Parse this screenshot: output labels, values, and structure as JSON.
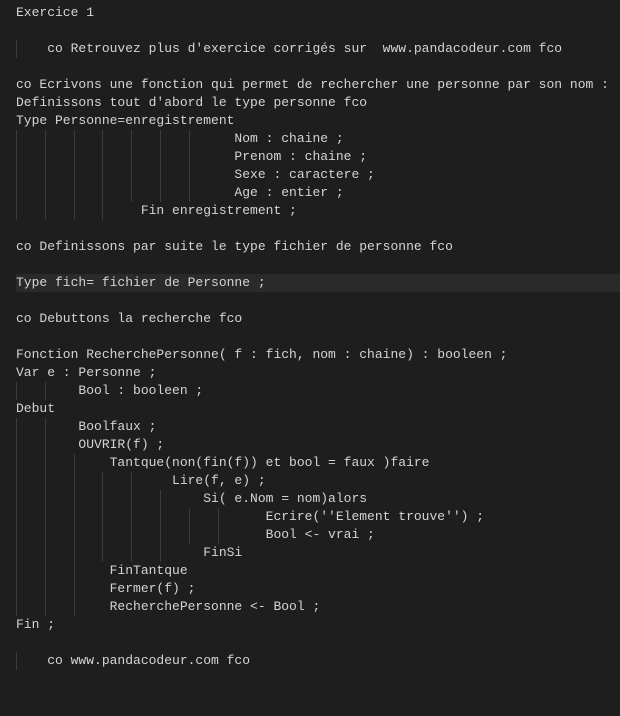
{
  "code": {
    "lines": [
      {
        "indent": 0,
        "guides": 0,
        "text": "Exercice 1",
        "hl": false
      },
      {
        "indent": 0,
        "guides": 0,
        "text": "",
        "hl": false
      },
      {
        "indent": 1,
        "guides": 1,
        "text": "co Retrouvez plus d'exercice corrigés sur  www.pandacodeur.com fco",
        "hl": false
      },
      {
        "indent": 0,
        "guides": 0,
        "text": "",
        "hl": false
      },
      {
        "indent": 0,
        "guides": 0,
        "text": "co Ecrivons une fonction qui permet de rechercher une personne par son nom :",
        "hl": false
      },
      {
        "indent": 0,
        "guides": 0,
        "text": "Definissons tout d'abord le type personne fco",
        "hl": false
      },
      {
        "indent": 0,
        "guides": 0,
        "text": "Type Personne=enregistrement",
        "hl": false
      },
      {
        "indent": 7,
        "guides": 7,
        "text": "Nom : chaine ;",
        "hl": false
      },
      {
        "indent": 7,
        "guides": 7,
        "text": "Prenom : chaine ;",
        "hl": false
      },
      {
        "indent": 7,
        "guides": 7,
        "text": "Sexe : caractere ;",
        "hl": false
      },
      {
        "indent": 7,
        "guides": 7,
        "text": "Age : entier ;",
        "hl": false
      },
      {
        "indent": 4,
        "guides": 4,
        "text": "Fin enregistrement ;",
        "hl": false
      },
      {
        "indent": 0,
        "guides": 0,
        "text": "",
        "hl": false
      },
      {
        "indent": 0,
        "guides": 0,
        "text": "co Definissons par suite le type fichier de personne fco",
        "hl": false
      },
      {
        "indent": 0,
        "guides": 0,
        "text": "",
        "hl": false
      },
      {
        "indent": 0,
        "guides": 0,
        "text": "Type fich= fichier de Personne ;",
        "hl": true
      },
      {
        "indent": 0,
        "guides": 0,
        "text": "",
        "hl": false
      },
      {
        "indent": 0,
        "guides": 0,
        "text": "co Debuttons la recherche fco",
        "hl": false
      },
      {
        "indent": 0,
        "guides": 0,
        "text": "",
        "hl": false
      },
      {
        "indent": 0,
        "guides": 0,
        "text": "Fonction RecherchePersonne( f : fich, nom : chaine) : booleen ;",
        "hl": false
      },
      {
        "indent": 0,
        "guides": 0,
        "text": "Var e : Personne ;",
        "hl": false
      },
      {
        "indent": 2,
        "guides": 2,
        "text": "Bool : booleen ;",
        "hl": false
      },
      {
        "indent": 0,
        "guides": 0,
        "text": "Debut",
        "hl": false
      },
      {
        "indent": 2,
        "guides": 2,
        "text": "Boolfaux ;",
        "hl": false
      },
      {
        "indent": 2,
        "guides": 2,
        "text": "OUVRIR(f) ;",
        "hl": false
      },
      {
        "indent": 3,
        "guides": 3,
        "text": "Tantque(non(fin(f)) et bool = faux )faire",
        "hl": false
      },
      {
        "indent": 5,
        "guides": 5,
        "text": "Lire(f, e) ;",
        "hl": false
      },
      {
        "indent": 6,
        "guides": 6,
        "text": "Si( e.Nom = nom)alors",
        "hl": false
      },
      {
        "indent": 8,
        "guides": 8,
        "text": "Ecrire(''Element trouve'') ;",
        "hl": false
      },
      {
        "indent": 8,
        "guides": 8,
        "text": "Bool <- vrai ;",
        "hl": false
      },
      {
        "indent": 6,
        "guides": 6,
        "text": "FinSi",
        "hl": false
      },
      {
        "indent": 3,
        "guides": 3,
        "text": "FinTantque",
        "hl": false
      },
      {
        "indent": 3,
        "guides": 3,
        "text": "Fermer(f) ;",
        "hl": false
      },
      {
        "indent": 3,
        "guides": 3,
        "text": "RecherchePersonne <- Bool ;",
        "hl": false
      },
      {
        "indent": 0,
        "guides": 0,
        "text": "Fin ;",
        "hl": false
      },
      {
        "indent": 0,
        "guides": 0,
        "text": "",
        "hl": false
      },
      {
        "indent": 1,
        "guides": 1,
        "text": "co www.pandacodeur.com fco",
        "hl": false
      }
    ]
  },
  "style": {
    "tabSize": 4,
    "charWidth": 7.2
  }
}
